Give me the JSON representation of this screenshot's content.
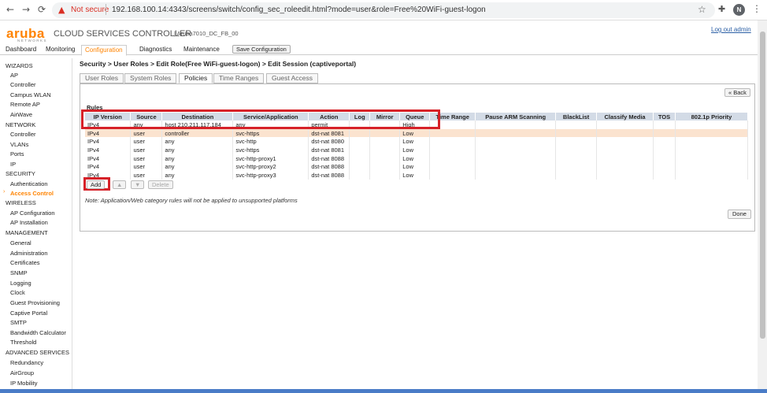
{
  "browser": {
    "not_secure": "Not secure",
    "url": "192.168.100.14:4343/screens/switch/config_sec_roleedit.html?mode=user&role=Free%20WiFi-guest-logon",
    "profile_initial": "N"
  },
  "header": {
    "logo": "aruba",
    "logo_sub": "NETWORKS",
    "product": "CLOUD SERVICES CONTROLLER",
    "controller": "Aruba7010_DC_FB_00",
    "logout": "Log out admin"
  },
  "top_tabs": [
    "Dashboard",
    "Monitoring",
    "Configuration",
    "Diagnostics",
    "Maintenance"
  ],
  "save_config": "Save Configuration",
  "sidebar": [
    {
      "type": "sec",
      "label": "WIZARDS"
    },
    {
      "type": "item",
      "label": "AP"
    },
    {
      "type": "item",
      "label": "Controller"
    },
    {
      "type": "item",
      "label": "Campus WLAN"
    },
    {
      "type": "item",
      "label": "Remote AP"
    },
    {
      "type": "item",
      "label": "AirWave"
    },
    {
      "type": "sec",
      "label": "NETWORK"
    },
    {
      "type": "item",
      "label": "Controller"
    },
    {
      "type": "item",
      "label": "VLANs"
    },
    {
      "type": "item",
      "label": "Ports"
    },
    {
      "type": "item",
      "label": "IP"
    },
    {
      "type": "sec",
      "label": "SECURITY"
    },
    {
      "type": "item",
      "label": "Authentication"
    },
    {
      "type": "item",
      "label": "Access Control",
      "active": true
    },
    {
      "type": "sec",
      "label": "WIRELESS"
    },
    {
      "type": "item",
      "label": "AP Configuration"
    },
    {
      "type": "item",
      "label": "AP Installation"
    },
    {
      "type": "sec",
      "label": "MANAGEMENT"
    },
    {
      "type": "item",
      "label": "General"
    },
    {
      "type": "item",
      "label": "Administration"
    },
    {
      "type": "item",
      "label": "Certificates"
    },
    {
      "type": "item",
      "label": "SNMP"
    },
    {
      "type": "item",
      "label": "Logging"
    },
    {
      "type": "item",
      "label": "Clock"
    },
    {
      "type": "item",
      "label": "Guest Provisioning"
    },
    {
      "type": "item",
      "label": "Captive Portal"
    },
    {
      "type": "item",
      "label": "SMTP"
    },
    {
      "type": "item",
      "label": "Bandwidth Calculator"
    },
    {
      "type": "item",
      "label": "Threshold"
    },
    {
      "type": "sec",
      "label": "ADVANCED SERVICES"
    },
    {
      "type": "item",
      "label": "Redundancy"
    },
    {
      "type": "item",
      "label": "AirGroup"
    },
    {
      "type": "item",
      "label": "IP Mobility"
    }
  ],
  "main": {
    "breadcrumb": "Security > User Roles > Edit Role(Free WiFi-guest-logon) > Edit Session (captiveportal)",
    "sub_tabs": [
      "User Roles",
      "System Roles",
      "Policies",
      "Time Ranges",
      "Guest Access"
    ],
    "back": "« Back",
    "rules_label": "Rules",
    "columns": [
      "IP Version",
      "Source",
      "Destination",
      "Service/Application",
      "Action",
      "Log",
      "Mirror",
      "Queue",
      "Time Range",
      "Pause ARM Scanning",
      "BlackList",
      "Classify Media",
      "TOS",
      "802.1p Priority"
    ],
    "rows": [
      [
        "IPv4",
        "any",
        "host 210.211.117.184",
        "any",
        "permit",
        "",
        "",
        "High",
        "",
        "",
        "",
        "",
        "",
        ""
      ],
      [
        "IPv4",
        "user",
        "controller",
        "svc-https",
        "dst-nat 8081",
        "",
        "",
        "Low",
        "",
        "",
        "",
        "",
        "",
        ""
      ],
      [
        "IPv4",
        "user",
        "any",
        "svc-http",
        "dst-nat 8080",
        "",
        "",
        "Low",
        "",
        "",
        "",
        "",
        "",
        ""
      ],
      [
        "IPv4",
        "user",
        "any",
        "svc-https",
        "dst-nat 8081",
        "",
        "",
        "Low",
        "",
        "",
        "",
        "",
        "",
        ""
      ],
      [
        "IPv4",
        "user",
        "any",
        "svc-http-proxy1",
        "dst-nat 8088",
        "",
        "",
        "Low",
        "",
        "",
        "",
        "",
        "",
        ""
      ],
      [
        "IPv4",
        "user",
        "any",
        "svc-http-proxy2",
        "dst-nat 8088",
        "",
        "",
        "Low",
        "",
        "",
        "",
        "",
        "",
        ""
      ],
      [
        "IPv4",
        "user",
        "any",
        "svc-http-proxy3",
        "dst-nat 8088",
        "",
        "",
        "Low",
        "",
        "",
        "",
        "",
        "",
        ""
      ]
    ],
    "highlight_row": 1,
    "buttons": {
      "add": "Add",
      "up": "▲",
      "down": "▼",
      "delete": "Delete"
    },
    "note": "Note: Application/Web category rules will not be applied to unsupported platforms",
    "done": "Done"
  },
  "colors": {
    "accent": "#ff8300",
    "header_row": "#d3dbe6",
    "highlight_row": "#fbe3cf",
    "annotation": "#d62128"
  }
}
